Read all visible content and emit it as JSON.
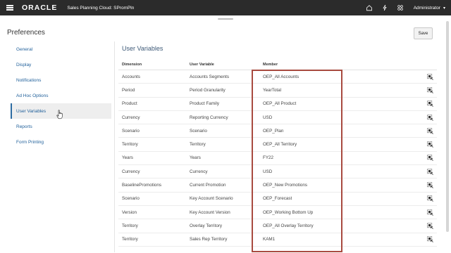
{
  "app": {
    "logo": "ORACLE",
    "title": "Sales Planning Cloud: SPromPln",
    "user": "Administrator"
  },
  "icons": {
    "home": "home-icon",
    "navigator": "lightning-icon",
    "apps": "grid-icon",
    "menu": "hamburger-menu-icon",
    "select_member": "member-selector-icon"
  },
  "header": {
    "title": "Preferences",
    "save_label": "Save"
  },
  "nav": {
    "items": [
      {
        "label": "General"
      },
      {
        "label": "Display"
      },
      {
        "label": "Notifications"
      },
      {
        "label": "Ad Hoc Options"
      },
      {
        "label": "User Variables"
      },
      {
        "label": "Reports"
      },
      {
        "label": "Form Printing"
      }
    ],
    "active_index": 4
  },
  "main": {
    "section_title": "User Variables",
    "columns": {
      "dimension": "Dimension",
      "user_variable": "User Variable",
      "member": "Member"
    },
    "rows": [
      {
        "dimension": "Accounts",
        "user_variable": "Accounts Segments",
        "member": "OEP_All Accounts"
      },
      {
        "dimension": "Period",
        "user_variable": "Period Granularity",
        "member": "YearTotal"
      },
      {
        "dimension": "Product",
        "user_variable": "Product Family",
        "member": "OEP_All Product"
      },
      {
        "dimension": "Currency",
        "user_variable": "Reporting Currency",
        "member": "USD"
      },
      {
        "dimension": "Scenario",
        "user_variable": "Scenario",
        "member": "OEP_Plan"
      },
      {
        "dimension": "Territory",
        "user_variable": "Territory",
        "member": "OEP_All Territory"
      },
      {
        "dimension": "Years",
        "user_variable": "Years",
        "member": "FY22"
      },
      {
        "dimension": "Currency",
        "user_variable": "Currency",
        "member": "USD"
      },
      {
        "dimension": "BaselinePromotions",
        "user_variable": "Current Promotion",
        "member": "OEP_New Promotions"
      },
      {
        "dimension": "Scenario",
        "user_variable": "Key Account Scenario",
        "member": "OEP_Forecast"
      },
      {
        "dimension": "Version",
        "user_variable": "Key Account Version",
        "member": "OEP_Working Bottom Up"
      },
      {
        "dimension": "Territory",
        "user_variable": "Overlay Territory",
        "member": "OEP_All Overlay Territory"
      },
      {
        "dimension": "Territory",
        "user_variable": "Sales Rep Territory",
        "member": "KAM1"
      }
    ]
  },
  "colors": {
    "topbar": "#2b2b2b",
    "nav_link": "#1f5f9a",
    "highlight_box": "#a84a3f"
  }
}
